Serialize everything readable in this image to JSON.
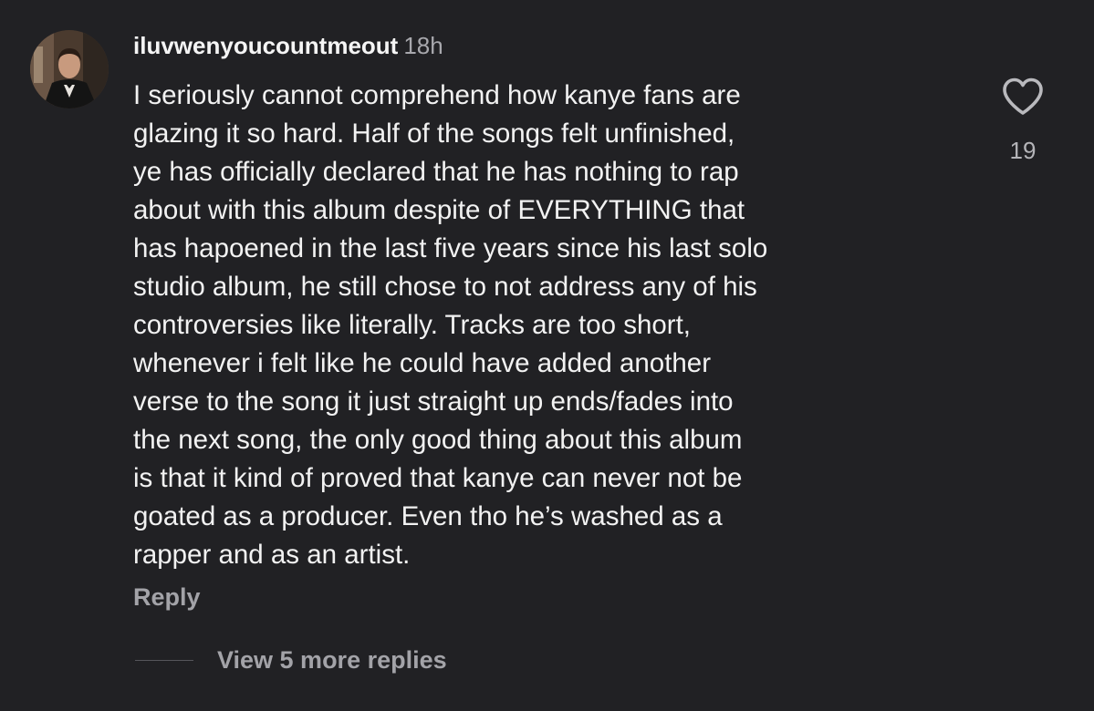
{
  "comment": {
    "username": "iluvwenyoucountmeout",
    "timestamp": "18h",
    "lines": [
      "I seriously cannot comprehend how kanye fans are",
      "glazing it so hard. Half of the songs felt unfinished,",
      "ye has officially declared that he has nothing to rap",
      "about with this album despite of EVERYTHING that",
      "has hapoened in the last five years since his last solo",
      "studio album, he still chose to not address any of his",
      "controversies like literally. Tracks are too short,",
      "whenever i felt like he could have added another",
      "verse to the song it just straight up ends/fades into",
      "the next song, the only good thing about this album",
      "is that it kind of proved that kanye can never not be",
      "goated as a producer. Even tho he’s washed as a",
      "rapper and as an artist."
    ],
    "like_count": "19",
    "reply_label": "Reply",
    "view_replies_label": "View 5 more replies"
  },
  "icons": {
    "like": "heart-outline-icon",
    "avatar": "profile-photo"
  },
  "colors": {
    "background": "#212124",
    "text_primary": "#f2f2f2",
    "text_secondary": "#a3a3a8"
  }
}
